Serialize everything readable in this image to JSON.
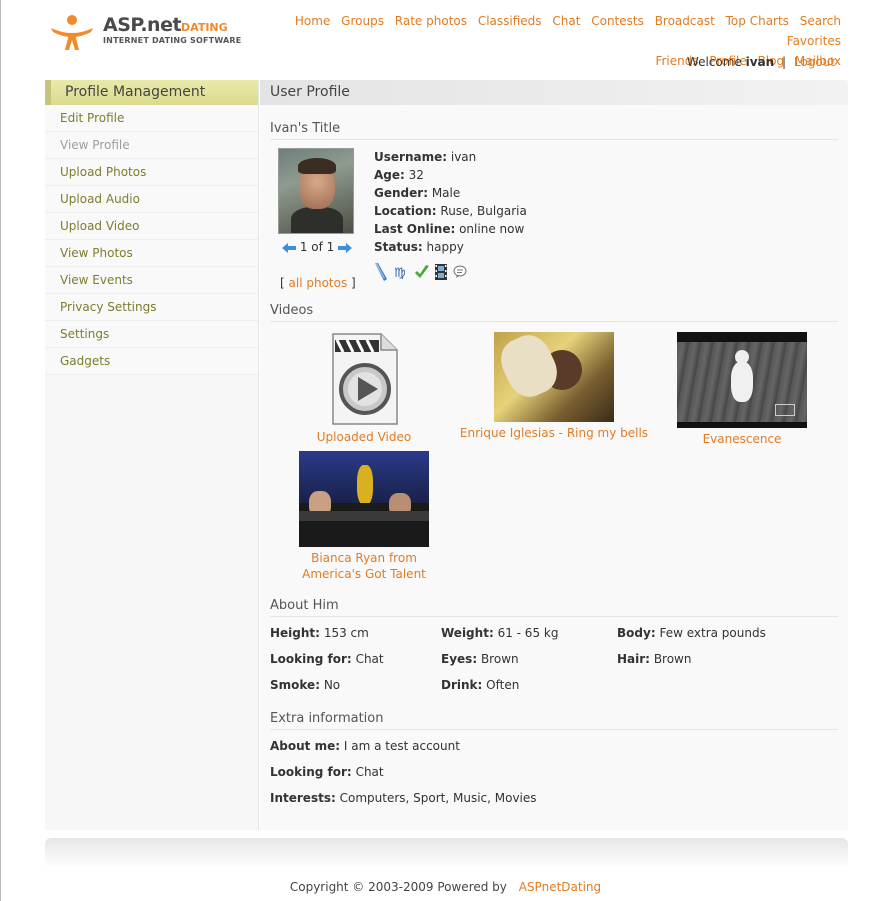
{
  "header": {
    "logo_brand": "ASP.net",
    "logo_brand_suffix": "DATING",
    "logo_tagline": "INTERNET DATING SOFTWARE",
    "nav": [
      "Home",
      "Groups",
      "Rate photos",
      "Classifieds",
      "Chat",
      "Contests",
      "Broadcast",
      "Top Charts",
      "Search",
      "Favorites",
      "Friends",
      "Profile",
      "Blog",
      "Mailbox"
    ],
    "welcome_prefix": "Welcome",
    "username": "ivan",
    "separator": "|",
    "logout": "Logout"
  },
  "sidebar": {
    "title": "Profile Management",
    "items": [
      {
        "label": "Edit Profile"
      },
      {
        "label": "View Profile"
      },
      {
        "label": "Upload Photos"
      },
      {
        "label": "Upload Audio"
      },
      {
        "label": "Upload Video"
      },
      {
        "label": "View Photos"
      },
      {
        "label": "View Events"
      },
      {
        "label": "Privacy Settings"
      },
      {
        "label": "Settings"
      },
      {
        "label": "Gadgets"
      }
    ]
  },
  "main": {
    "title": "User Profile",
    "profile_title": "Ivan's Title",
    "photo_counter": "1 of 1",
    "all_photos_open": "[",
    "all_photos": "all photos",
    "all_photos_close": "]",
    "fields": [
      {
        "label": "Username",
        "value": "ivan"
      },
      {
        "label": "Age",
        "value": "32"
      },
      {
        "label": "Gender",
        "value": "Male"
      },
      {
        "label": "Location",
        "value": "Ruse, Bulgaria"
      },
      {
        "label": "Last Online",
        "value": "online now"
      },
      {
        "label": "Status",
        "value": "happy"
      }
    ],
    "status_icons": [
      "pen-icon",
      "virgo-sign-icon",
      "checkmark-icon",
      "film-icon",
      "chat-bubble-icon"
    ],
    "videos_title": "Videos",
    "videos": [
      {
        "title": "Uploaded Video"
      },
      {
        "title": "Enrique Iglesias - Ring my bells"
      },
      {
        "title": "Evanescence"
      },
      {
        "title": "Bianca Ryan from America's Got Talent"
      }
    ],
    "about_title": "About Him",
    "about": [
      {
        "label": "Height",
        "value": "153 cm"
      },
      {
        "label": "Weight",
        "value": "61 - 65 kg"
      },
      {
        "label": "Body",
        "value": "Few extra pounds"
      },
      {
        "label": "Looking for",
        "value": "Chat"
      },
      {
        "label": "Eyes",
        "value": "Brown"
      },
      {
        "label": "Hair",
        "value": "Brown"
      },
      {
        "label": "Smoke",
        "value": "No"
      },
      {
        "label": "Drink",
        "value": "Often"
      }
    ],
    "extra_title": "Extra information",
    "extra": [
      {
        "label": "About me",
        "value": "I am a test account"
      },
      {
        "label": "Looking for",
        "value": "Chat"
      },
      {
        "label": "Interests",
        "value": "Computers, Sport, Music, Movies"
      }
    ]
  },
  "footer": {
    "copyright": "Copyright © 2003-2009 Powered by",
    "powered_link": "ASPnetDating"
  },
  "colors": {
    "link": "#e07c24",
    "sidebar_link": "#7c7d2e",
    "sidebar_header": "#dadb8f"
  }
}
